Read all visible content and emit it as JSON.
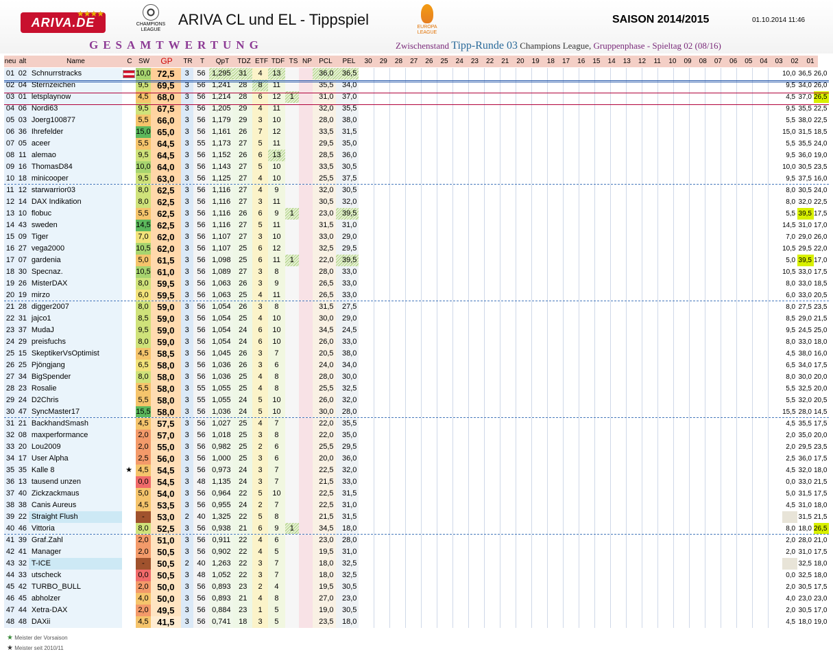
{
  "header": {
    "logo": "ARIVA.DE",
    "logo_stars": "★★★★",
    "cl_logo_text": "CHAMPIONS LEAGUE",
    "title": "ARIVA CL und EL - Tippspiel",
    "el_logo_text": "EUROPA LEAGUE",
    "season": "SAISON 2014/2015",
    "datetime": "01.10.2014 11:46",
    "gesamt": "GESAMTWERTUNG",
    "zw_pre": "Zwischenstand",
    "zw_round": "Tipp-Runde 03",
    "zw_comp": "Champions League,",
    "zw_phase": "Gruppenphase - Spieltag 02 (08/16)"
  },
  "columns": [
    "neu",
    "alt",
    "Name",
    "C",
    "SW",
    "GP",
    "TR",
    "T",
    "QpT",
    "TDZ",
    "ETF",
    "TDF",
    "TS",
    "NP",
    "PCL",
    "PEL"
  ],
  "round_columns": [
    "30",
    "29",
    "28",
    "27",
    "26",
    "25",
    "24",
    "23",
    "22",
    "21",
    "20",
    "19",
    "18",
    "17",
    "16",
    "15",
    "14",
    "13",
    "12",
    "11",
    "10",
    "09",
    "08",
    "07",
    "06",
    "05",
    "04",
    "03",
    "02",
    "01"
  ],
  "colors": {
    "header_bar": "#f4cfc6",
    "accent_purple": "#8c3a94",
    "highlight": "#d8f000"
  },
  "rows": [
    {
      "neu": "01",
      "alt": "02",
      "name": "Schnurrstracks",
      "c": "flag",
      "sw": "10,0",
      "gp": "72,5",
      "tr": "3",
      "t": "56",
      "qpt": "1,295",
      "tdz": "31",
      "etf": "4",
      "tdf": "13",
      "ts": "",
      "np": "",
      "pcl": "36,0",
      "pel": "36,5",
      "r3": "10,0",
      "r2": "36,5",
      "r1": "26,0"
    },
    {
      "neu": "02",
      "alt": "04",
      "name": "Sternzeichen",
      "c": "",
      "sw": "9,5",
      "gp": "69,5",
      "tr": "3",
      "t": "56",
      "qpt": "1,241",
      "tdz": "28",
      "etf": "8",
      "tdf": "11",
      "ts": "",
      "np": "",
      "pcl": "35,5",
      "pel": "34,0",
      "r3": "9,5",
      "r2": "34,0",
      "r1": "26,0"
    },
    {
      "neu": "03",
      "alt": "01",
      "name": "letsplaynow",
      "c": "",
      "sw": "4,5",
      "gp": "68,0",
      "tr": "3",
      "t": "56",
      "qpt": "1,214",
      "tdz": "28",
      "etf": "6",
      "tdf": "12",
      "ts": "1",
      "np": "",
      "pcl": "31,0",
      "pel": "37,0",
      "r3": "4,5",
      "r2": "37,0",
      "r1": "26,5"
    },
    {
      "neu": "04",
      "alt": "06",
      "name": "Nordi63",
      "c": "",
      "sw": "9,5",
      "gp": "67,5",
      "tr": "3",
      "t": "56",
      "qpt": "1,205",
      "tdz": "29",
      "etf": "4",
      "tdf": "11",
      "ts": "",
      "np": "",
      "pcl": "32,0",
      "pel": "35,5",
      "r3": "9,5",
      "r2": "35,5",
      "r1": "22,5"
    },
    {
      "neu": "05",
      "alt": "03",
      "name": "Joerg100877",
      "c": "",
      "sw": "5,5",
      "gp": "66,0",
      "tr": "3",
      "t": "56",
      "qpt": "1,179",
      "tdz": "29",
      "etf": "3",
      "tdf": "10",
      "ts": "",
      "np": "",
      "pcl": "28,0",
      "pel": "38,0",
      "r3": "5,5",
      "r2": "38,0",
      "r1": "22,5"
    },
    {
      "neu": "06",
      "alt": "36",
      "name": "Ihrefelder",
      "c": "",
      "sw": "15,0",
      "gp": "65,0",
      "tr": "3",
      "t": "56",
      "qpt": "1,161",
      "tdz": "26",
      "etf": "7",
      "tdf": "12",
      "ts": "",
      "np": "",
      "pcl": "33,5",
      "pel": "31,5",
      "r3": "15,0",
      "r2": "31,5",
      "r1": "18,5"
    },
    {
      "neu": "07",
      "alt": "05",
      "name": "aceer",
      "c": "",
      "sw": "5,5",
      "gp": "64,5",
      "tr": "3",
      "t": "55",
      "qpt": "1,173",
      "tdz": "27",
      "etf": "5",
      "tdf": "11",
      "ts": "",
      "np": "",
      "pcl": "29,5",
      "pel": "35,0",
      "r3": "5,5",
      "r2": "35,5",
      "r1": "24,0"
    },
    {
      "neu": "08",
      "alt": "11",
      "name": "alemao",
      "c": "",
      "sw": "9,5",
      "gp": "64,5",
      "tr": "3",
      "t": "56",
      "qpt": "1,152",
      "tdz": "26",
      "etf": "6",
      "tdf": "13",
      "ts": "",
      "np": "",
      "pcl": "28,5",
      "pel": "36,0",
      "r3": "9,5",
      "r2": "36,0",
      "r1": "19,0"
    },
    {
      "neu": "09",
      "alt": "16",
      "name": "ThomasD84",
      "c": "",
      "sw": "10,0",
      "gp": "64,0",
      "tr": "3",
      "t": "56",
      "qpt": "1,143",
      "tdz": "27",
      "etf": "5",
      "tdf": "10",
      "ts": "",
      "np": "",
      "pcl": "33,5",
      "pel": "30,5",
      "r3": "10,0",
      "r2": "30,5",
      "r1": "23,5"
    },
    {
      "neu": "10",
      "alt": "18",
      "name": "minicooper",
      "c": "",
      "sw": "9,5",
      "gp": "63,0",
      "tr": "3",
      "t": "56",
      "qpt": "1,125",
      "tdz": "27",
      "etf": "4",
      "tdf": "10",
      "ts": "",
      "np": "",
      "pcl": "25,5",
      "pel": "37,5",
      "r3": "9,5",
      "r2": "37,5",
      "r1": "16,0"
    },
    {
      "neu": "11",
      "alt": "12",
      "name": "starwarrior03",
      "c": "",
      "sw": "8,0",
      "gp": "62,5",
      "tr": "3",
      "t": "56",
      "qpt": "1,116",
      "tdz": "27",
      "etf": "4",
      "tdf": "9",
      "ts": "",
      "np": "",
      "pcl": "32,0",
      "pel": "30,5",
      "r3": "8,0",
      "r2": "30,5",
      "r1": "24,0"
    },
    {
      "neu": "12",
      "alt": "14",
      "name": "DAX Indikation",
      "c": "",
      "sw": "8,0",
      "gp": "62,5",
      "tr": "3",
      "t": "56",
      "qpt": "1,116",
      "tdz": "27",
      "etf": "3",
      "tdf": "11",
      "ts": "",
      "np": "",
      "pcl": "30,5",
      "pel": "32,0",
      "r3": "8,0",
      "r2": "32,0",
      "r1": "22,5"
    },
    {
      "neu": "13",
      "alt": "10",
      "name": "flobuc",
      "c": "",
      "sw": "5,5",
      "gp": "62,5",
      "tr": "3",
      "t": "56",
      "qpt": "1,116",
      "tdz": "26",
      "etf": "6",
      "tdf": "9",
      "ts": "1",
      "np": "",
      "pcl": "23,0",
      "pel": "39,5",
      "r3": "5,5",
      "r2": "39,5",
      "r1": "17,5"
    },
    {
      "neu": "14",
      "alt": "43",
      "name": "sweden",
      "c": "",
      "sw": "14,5",
      "gp": "62,5",
      "tr": "3",
      "t": "56",
      "qpt": "1,116",
      "tdz": "27",
      "etf": "5",
      "tdf": "11",
      "ts": "",
      "np": "",
      "pcl": "31,5",
      "pel": "31,0",
      "r3": "14,5",
      "r2": "31,0",
      "r1": "17,0"
    },
    {
      "neu": "15",
      "alt": "09",
      "name": "Tiger",
      "c": "",
      "sw": "7,0",
      "gp": "62,0",
      "tr": "3",
      "t": "56",
      "qpt": "1,107",
      "tdz": "27",
      "etf": "3",
      "tdf": "10",
      "ts": "",
      "np": "",
      "pcl": "33,0",
      "pel": "29,0",
      "r3": "7,0",
      "r2": "29,0",
      "r1": "26,0"
    },
    {
      "neu": "16",
      "alt": "27",
      "name": "vega2000",
      "c": "",
      "sw": "10,5",
      "gp": "62,0",
      "tr": "3",
      "t": "56",
      "qpt": "1,107",
      "tdz": "25",
      "etf": "6",
      "tdf": "12",
      "ts": "",
      "np": "",
      "pcl": "32,5",
      "pel": "29,5",
      "r3": "10,5",
      "r2": "29,5",
      "r1": "22,0"
    },
    {
      "neu": "17",
      "alt": "07",
      "name": "gardenia",
      "c": "",
      "sw": "5,0",
      "gp": "61,5",
      "tr": "3",
      "t": "56",
      "qpt": "1,098",
      "tdz": "25",
      "etf": "6",
      "tdf": "11",
      "ts": "1",
      "np": "",
      "pcl": "22,0",
      "pel": "39,5",
      "r3": "5,0",
      "r2": "39,5",
      "r1": "17,0"
    },
    {
      "neu": "18",
      "alt": "30",
      "name": "Specnaz.",
      "c": "",
      "sw": "10,5",
      "gp": "61,0",
      "tr": "3",
      "t": "56",
      "qpt": "1,089",
      "tdz": "27",
      "etf": "3",
      "tdf": "8",
      "ts": "",
      "np": "",
      "pcl": "28,0",
      "pel": "33,0",
      "r3": "10,5",
      "r2": "33,0",
      "r1": "17,5"
    },
    {
      "neu": "19",
      "alt": "26",
      "name": "MisterDAX",
      "c": "",
      "sw": "8,0",
      "gp": "59,5",
      "tr": "3",
      "t": "56",
      "qpt": "1,063",
      "tdz": "26",
      "etf": "3",
      "tdf": "9",
      "ts": "",
      "np": "",
      "pcl": "26,5",
      "pel": "33,0",
      "r3": "8,0",
      "r2": "33,0",
      "r1": "18,5"
    },
    {
      "neu": "20",
      "alt": "19",
      "name": "mirzo",
      "c": "",
      "sw": "6,0",
      "gp": "59,5",
      "tr": "3",
      "t": "56",
      "qpt": "1,063",
      "tdz": "25",
      "etf": "4",
      "tdf": "11",
      "ts": "",
      "np": "",
      "pcl": "26,5",
      "pel": "33,0",
      "r3": "6,0",
      "r2": "33,0",
      "r1": "20,5"
    },
    {
      "neu": "21",
      "alt": "28",
      "name": "digger2007",
      "c": "",
      "sw": "8,0",
      "gp": "59,0",
      "tr": "3",
      "t": "56",
      "qpt": "1,054",
      "tdz": "26",
      "etf": "3",
      "tdf": "8",
      "ts": "",
      "np": "",
      "pcl": "31,5",
      "pel": "27,5",
      "r3": "8,0",
      "r2": "27,5",
      "r1": "23,5"
    },
    {
      "neu": "22",
      "alt": "31",
      "name": "jajco1",
      "c": "",
      "sw": "8,5",
      "gp": "59,0",
      "tr": "3",
      "t": "56",
      "qpt": "1,054",
      "tdz": "25",
      "etf": "4",
      "tdf": "10",
      "ts": "",
      "np": "",
      "pcl": "30,0",
      "pel": "29,0",
      "r3": "8,5",
      "r2": "29,0",
      "r1": "21,5"
    },
    {
      "neu": "23",
      "alt": "37",
      "name": "MudaJ",
      "c": "",
      "sw": "9,5",
      "gp": "59,0",
      "tr": "3",
      "t": "56",
      "qpt": "1,054",
      "tdz": "24",
      "etf": "6",
      "tdf": "10",
      "ts": "",
      "np": "",
      "pcl": "34,5",
      "pel": "24,5",
      "r3": "9,5",
      "r2": "24,5",
      "r1": "25,0"
    },
    {
      "neu": "24",
      "alt": "29",
      "name": "preisfuchs",
      "c": "",
      "sw": "8,0",
      "gp": "59,0",
      "tr": "3",
      "t": "56",
      "qpt": "1,054",
      "tdz": "24",
      "etf": "6",
      "tdf": "10",
      "ts": "",
      "np": "",
      "pcl": "26,0",
      "pel": "33,0",
      "r3": "8,0",
      "r2": "33,0",
      "r1": "18,0"
    },
    {
      "neu": "25",
      "alt": "15",
      "name": "SkeptikerVsOptimist",
      "c": "",
      "sw": "4,5",
      "gp": "58,5",
      "tr": "3",
      "t": "56",
      "qpt": "1,045",
      "tdz": "26",
      "etf": "3",
      "tdf": "7",
      "ts": "",
      "np": "",
      "pcl": "20,5",
      "pel": "38,0",
      "r3": "4,5",
      "r2": "38,0",
      "r1": "16,0"
    },
    {
      "neu": "26",
      "alt": "25",
      "name": "Pjöngjang",
      "c": "",
      "sw": "6,5",
      "gp": "58,0",
      "tr": "3",
      "t": "56",
      "qpt": "1,036",
      "tdz": "26",
      "etf": "3",
      "tdf": "6",
      "ts": "",
      "np": "",
      "pcl": "24,0",
      "pel": "34,0",
      "r3": "6,5",
      "r2": "34,0",
      "r1": "17,5"
    },
    {
      "neu": "27",
      "alt": "34",
      "name": "BigSpender",
      "c": "",
      "sw": "8,0",
      "gp": "58,0",
      "tr": "3",
      "t": "56",
      "qpt": "1,036",
      "tdz": "25",
      "etf": "4",
      "tdf": "8",
      "ts": "",
      "np": "",
      "pcl": "28,0",
      "pel": "30,0",
      "r3": "8,0",
      "r2": "30,0",
      "r1": "20,0"
    },
    {
      "neu": "28",
      "alt": "23",
      "name": "Rosalie",
      "c": "",
      "sw": "5,5",
      "gp": "58,0",
      "tr": "3",
      "t": "55",
      "qpt": "1,055",
      "tdz": "25",
      "etf": "4",
      "tdf": "8",
      "ts": "",
      "np": "",
      "pcl": "25,5",
      "pel": "32,5",
      "r3": "5,5",
      "r2": "32,5",
      "r1": "20,0"
    },
    {
      "neu": "29",
      "alt": "24",
      "name": "D2Chris",
      "c": "",
      "sw": "5,5",
      "gp": "58,0",
      "tr": "3",
      "t": "55",
      "qpt": "1,055",
      "tdz": "24",
      "etf": "5",
      "tdf": "10",
      "ts": "",
      "np": "",
      "pcl": "26,0",
      "pel": "32,0",
      "r3": "5,5",
      "r2": "32,0",
      "r1": "20,5"
    },
    {
      "neu": "30",
      "alt": "47",
      "name": "SyncMaster17",
      "c": "",
      "sw": "15,5",
      "gp": "58,0",
      "tr": "3",
      "t": "56",
      "qpt": "1,036",
      "tdz": "24",
      "etf": "5",
      "tdf": "10",
      "ts": "",
      "np": "",
      "pcl": "30,0",
      "pel": "28,0",
      "r3": "15,5",
      "r2": "28,0",
      "r1": "14,5"
    },
    {
      "neu": "31",
      "alt": "21",
      "name": "BackhandSmash",
      "c": "",
      "sw": "4,5",
      "gp": "57,5",
      "tr": "3",
      "t": "56",
      "qpt": "1,027",
      "tdz": "25",
      "etf": "4",
      "tdf": "7",
      "ts": "",
      "np": "",
      "pcl": "22,0",
      "pel": "35,5",
      "r3": "4,5",
      "r2": "35,5",
      "r1": "17,5"
    },
    {
      "neu": "32",
      "alt": "08",
      "name": "maxperformance",
      "c": "",
      "sw": "2,0",
      "gp": "57,0",
      "tr": "3",
      "t": "56",
      "qpt": "1,018",
      "tdz": "25",
      "etf": "3",
      "tdf": "8",
      "ts": "",
      "np": "",
      "pcl": "22,0",
      "pel": "35,0",
      "r3": "2,0",
      "r2": "35,0",
      "r1": "20,0"
    },
    {
      "neu": "33",
      "alt": "20",
      "name": "Lou2009",
      "c": "",
      "sw": "2,0",
      "gp": "55,0",
      "tr": "3",
      "t": "56",
      "qpt": "0,982",
      "tdz": "25",
      "etf": "2",
      "tdf": "6",
      "ts": "",
      "np": "",
      "pcl": "25,5",
      "pel": "29,5",
      "r3": "2,0",
      "r2": "29,5",
      "r1": "23,5"
    },
    {
      "neu": "34",
      "alt": "17",
      "name": "User Alpha",
      "c": "",
      "sw": "2,5",
      "gp": "56,0",
      "tr": "3",
      "t": "56",
      "qpt": "1,000",
      "tdz": "25",
      "etf": "3",
      "tdf": "6",
      "ts": "",
      "np": "",
      "pcl": "20,0",
      "pel": "36,0",
      "r3": "2,5",
      "r2": "36,0",
      "r1": "17,5"
    },
    {
      "neu": "35",
      "alt": "35",
      "name": "Kalle 8",
      "c": "star",
      "sw": "4,5",
      "gp": "54,5",
      "tr": "3",
      "t": "56",
      "qpt": "0,973",
      "tdz": "24",
      "etf": "3",
      "tdf": "7",
      "ts": "",
      "np": "",
      "pcl": "22,5",
      "pel": "32,0",
      "r3": "4,5",
      "r2": "32,0",
      "r1": "18,0"
    },
    {
      "neu": "36",
      "alt": "13",
      "name": "tausend unzen",
      "c": "",
      "sw": "0,0",
      "gp": "54,5",
      "tr": "3",
      "t": "48",
      "qpt": "1,135",
      "tdz": "24",
      "etf": "3",
      "tdf": "7",
      "ts": "",
      "np": "",
      "pcl": "21,5",
      "pel": "33,0",
      "r3": "0,0",
      "r2": "33,0",
      "r1": "21,5"
    },
    {
      "neu": "37",
      "alt": "40",
      "name": "Zickzackmaus",
      "c": "",
      "sw": "5,0",
      "gp": "54,0",
      "tr": "3",
      "t": "56",
      "qpt": "0,964",
      "tdz": "22",
      "etf": "5",
      "tdf": "10",
      "ts": "",
      "np": "",
      "pcl": "22,5",
      "pel": "31,5",
      "r3": "5,0",
      "r2": "31,5",
      "r1": "17,5"
    },
    {
      "neu": "38",
      "alt": "38",
      "name": "Canis Aureus",
      "c": "",
      "sw": "4,5",
      "gp": "53,5",
      "tr": "3",
      "t": "56",
      "qpt": "0,955",
      "tdz": "24",
      "etf": "2",
      "tdf": "7",
      "ts": "",
      "np": "",
      "pcl": "22,5",
      "pel": "31,0",
      "r3": "4,5",
      "r2": "31,0",
      "r1": "18,0"
    },
    {
      "neu": "39",
      "alt": "22",
      "name": "Straight Flush",
      "c": "",
      "sw": "-",
      "gp": "53,0",
      "tr": "2",
      "t": "40",
      "qpt": "1,325",
      "tdz": "22",
      "etf": "5",
      "tdf": "8",
      "ts": "",
      "np": "",
      "pcl": "21,5",
      "pel": "31,5",
      "r3": "",
      "r2": "31,5",
      "r1": "21,5"
    },
    {
      "neu": "40",
      "alt": "46",
      "name": "Vittoria",
      "c": "",
      "sw": "8,0",
      "gp": "52,5",
      "tr": "3",
      "t": "56",
      "qpt": "0,938",
      "tdz": "21",
      "etf": "6",
      "tdf": "9",
      "ts": "1",
      "np": "",
      "pcl": "34,5",
      "pel": "18,0",
      "r3": "8,0",
      "r2": "18,0",
      "r1": "26,5"
    },
    {
      "neu": "41",
      "alt": "39",
      "name": "Graf.Zahl",
      "c": "",
      "sw": "2,0",
      "gp": "51,0",
      "tr": "3",
      "t": "56",
      "qpt": "0,911",
      "tdz": "22",
      "etf": "4",
      "tdf": "6",
      "ts": "",
      "np": "",
      "pcl": "23,0",
      "pel": "28,0",
      "r3": "2,0",
      "r2": "28,0",
      "r1": "21,0"
    },
    {
      "neu": "42",
      "alt": "41",
      "name": "Manager",
      "c": "",
      "sw": "2,0",
      "gp": "50,5",
      "tr": "3",
      "t": "56",
      "qpt": "0,902",
      "tdz": "22",
      "etf": "4",
      "tdf": "5",
      "ts": "",
      "np": "",
      "pcl": "19,5",
      "pel": "31,0",
      "r3": "2,0",
      "r2": "31,0",
      "r1": "17,5"
    },
    {
      "neu": "43",
      "alt": "32",
      "name": "T-ICE",
      "c": "",
      "sw": "-",
      "gp": "50,5",
      "tr": "2",
      "t": "40",
      "qpt": "1,263",
      "tdz": "22",
      "etf": "3",
      "tdf": "7",
      "ts": "",
      "np": "",
      "pcl": "18,0",
      "pel": "32,5",
      "r3": "",
      "r2": "32,5",
      "r1": "18,0"
    },
    {
      "neu": "44",
      "alt": "33",
      "name": "utscheck",
      "c": "",
      "sw": "0,0",
      "gp": "50,5",
      "tr": "3",
      "t": "48",
      "qpt": "1,052",
      "tdz": "22",
      "etf": "3",
      "tdf": "7",
      "ts": "",
      "np": "",
      "pcl": "18,0",
      "pel": "32,5",
      "r3": "0,0",
      "r2": "32,5",
      "r1": "18,0"
    },
    {
      "neu": "45",
      "alt": "42",
      "name": "TURBO_BULL",
      "c": "",
      "sw": "2,0",
      "gp": "50,0",
      "tr": "3",
      "t": "56",
      "qpt": "0,893",
      "tdz": "23",
      "etf": "2",
      "tdf": "4",
      "ts": "",
      "np": "",
      "pcl": "19,5",
      "pel": "30,5",
      "r3": "2,0",
      "r2": "30,5",
      "r1": "17,5"
    },
    {
      "neu": "46",
      "alt": "45",
      "name": "abholzer",
      "c": "",
      "sw": "4,0",
      "gp": "50,0",
      "tr": "3",
      "t": "56",
      "qpt": "0,893",
      "tdz": "21",
      "etf": "4",
      "tdf": "8",
      "ts": "",
      "np": "",
      "pcl": "27,0",
      "pel": "23,0",
      "r3": "4,0",
      "r2": "23,0",
      "r1": "23,0"
    },
    {
      "neu": "47",
      "alt": "44",
      "name": "Xetra-DAX",
      "c": "",
      "sw": "2,0",
      "gp": "49,5",
      "tr": "3",
      "t": "56",
      "qpt": "0,884",
      "tdz": "23",
      "etf": "1",
      "tdf": "5",
      "ts": "",
      "np": "",
      "pcl": "19,0",
      "pel": "30,5",
      "r3": "2,0",
      "r2": "30,5",
      "r1": "17,0"
    },
    {
      "neu": "48",
      "alt": "48",
      "name": "DAXii",
      "c": "",
      "sw": "4,5",
      "gp": "41,5",
      "tr": "3",
      "t": "56",
      "qpt": "0,741",
      "tdz": "18",
      "etf": "3",
      "tdf": "5",
      "ts": "",
      "np": "",
      "pcl": "23,5",
      "pel": "18,0",
      "r3": "4,5",
      "r2": "18,0",
      "r1": "19,0"
    }
  ],
  "footer": {
    "meister_vorsaison": "Meister der Vorsaison",
    "meister_seit": "Meister seit 2010/11"
  }
}
